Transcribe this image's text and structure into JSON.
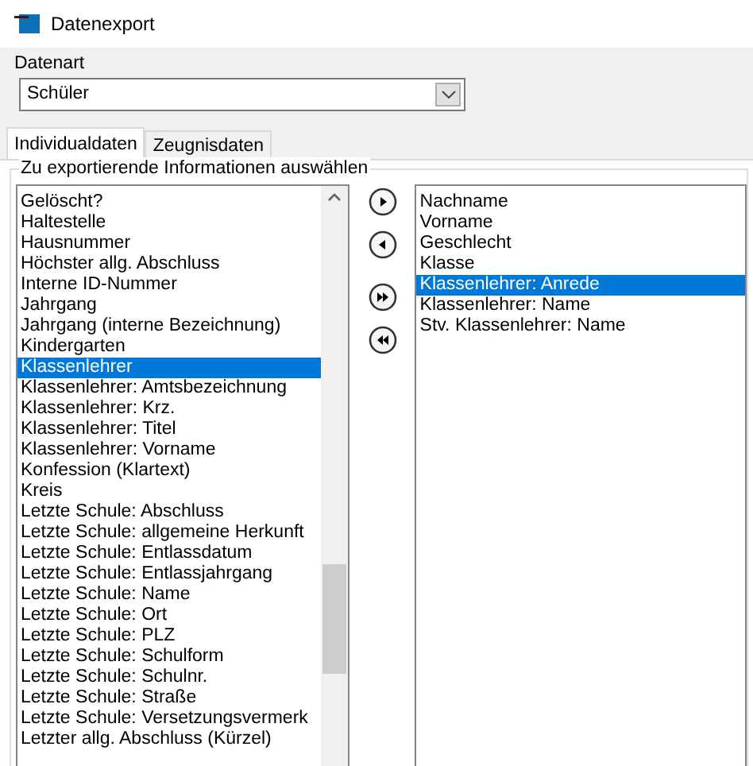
{
  "window": {
    "title": "Datenexport"
  },
  "datenart": {
    "label": "Datenart",
    "value": "Schüler"
  },
  "tabs": [
    {
      "label": "Individualdaten",
      "selected": true
    },
    {
      "label": "Zeugnisdaten",
      "selected": false
    }
  ],
  "group": {
    "title": "Zu exportierende Informationen auswählen"
  },
  "available": [
    {
      "label": "Gelöscht?",
      "selected": false
    },
    {
      "label": "Haltestelle",
      "selected": false
    },
    {
      "label": "Hausnummer",
      "selected": false
    },
    {
      "label": "Höchster allg. Abschluss",
      "selected": false
    },
    {
      "label": "Interne ID-Nummer",
      "selected": false
    },
    {
      "label": "Jahrgang",
      "selected": false
    },
    {
      "label": "Jahrgang (interne Bezeichnung)",
      "selected": false
    },
    {
      "label": "Kindergarten",
      "selected": false
    },
    {
      "label": "Klassenlehrer",
      "selected": true
    },
    {
      "label": "Klassenlehrer: Amtsbezeichnung",
      "selected": false
    },
    {
      "label": "Klassenlehrer: Krz.",
      "selected": false
    },
    {
      "label": "Klassenlehrer: Titel",
      "selected": false
    },
    {
      "label": "Klassenlehrer: Vorname",
      "selected": false
    },
    {
      "label": "Konfession (Klartext)",
      "selected": false
    },
    {
      "label": "Kreis",
      "selected": false
    },
    {
      "label": "Letzte Schule: Abschluss",
      "selected": false
    },
    {
      "label": "Letzte Schule: allgemeine Herkunft",
      "selected": false
    },
    {
      "label": "Letzte Schule: Entlassdatum",
      "selected": false
    },
    {
      "label": "Letzte Schule: Entlassjahrgang",
      "selected": false
    },
    {
      "label": "Letzte Schule: Name",
      "selected": false
    },
    {
      "label": "Letzte Schule: Ort",
      "selected": false
    },
    {
      "label": "Letzte Schule: PLZ",
      "selected": false
    },
    {
      "label": "Letzte Schule: Schulform",
      "selected": false
    },
    {
      "label": "Letzte Schule: Schulnr.",
      "selected": false
    },
    {
      "label": "Letzte Schule: Straße",
      "selected": false
    },
    {
      "label": "Letzte Schule: Versetzungsvermerk",
      "selected": false
    },
    {
      "label": "Letzter allg. Abschluss (Kürzel)",
      "selected": false
    }
  ],
  "buttons": [
    {
      "kind": "add"
    },
    {
      "kind": "remove"
    },
    {
      "kind": "add_all"
    },
    {
      "kind": "remove_all"
    }
  ],
  "chosen": [
    {
      "label": "Nachname",
      "selected": false
    },
    {
      "label": "Vorname",
      "selected": false
    },
    {
      "label": "Geschlecht",
      "selected": false
    },
    {
      "label": "Klasse",
      "selected": false
    },
    {
      "label": "Klassenlehrer: Anrede",
      "selected": true
    },
    {
      "label": "Klassenlehrer: Name",
      "selected": false
    },
    {
      "label": "Stv. Klassenlehrer: Name",
      "selected": false
    }
  ]
}
